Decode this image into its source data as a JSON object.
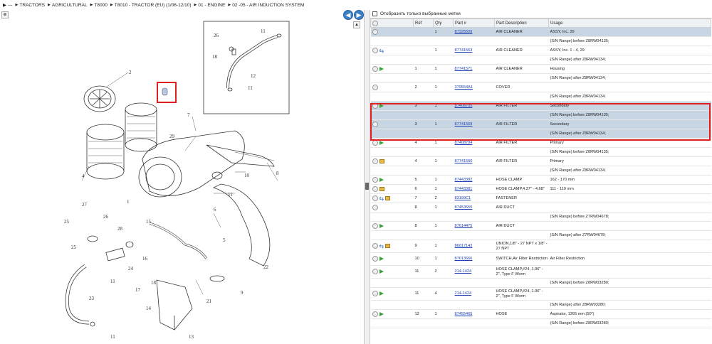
{
  "breadcrumb": {
    "items": [
      "---",
      "TRACTORS",
      "AGRICULTURAL",
      "T8000",
      "T8010 - TRACTOR (EU) (1/06-12/10)",
      "01 - ENGINE",
      "02 -05 - AIR INDUCTION SYSTEM"
    ]
  },
  "nav": {
    "back": "◀",
    "forward": "▶"
  },
  "filter": {
    "label": "Отобразить только выбранные метки"
  },
  "table": {
    "headers": [
      "",
      "Ref",
      "Qty",
      "Part #",
      "Part Description",
      "Usage"
    ],
    "rows": [
      {
        "icons": "",
        "ref": "",
        "qty": "1",
        "part": "87325509",
        "desc": "AIR CLEANER",
        "usage": "ASSY, Inc. 29",
        "sel": true
      },
      {
        "icons": "",
        "ref": "",
        "qty": "",
        "part": "",
        "desc": "",
        "usage": "(S/N Range) before Z8RW04135;",
        "sel": false
      },
      {
        "icons": "swap",
        "ref": "",
        "qty": "1",
        "part": "87741563",
        "desc": "AIR CLEANER",
        "usage": "ASSY, Inc. 1 - 4, 29",
        "sel": false
      },
      {
        "icons": "",
        "ref": "",
        "qty": "",
        "part": "",
        "desc": "",
        "usage": "(S/N Range) after Z8RW04134;",
        "sel": false
      },
      {
        "icons": "arrow",
        "ref": "1",
        "qty": "1",
        "part": "87741571",
        "desc": "AIR CLEANER",
        "usage": "Housing",
        "sel": false
      },
      {
        "icons": "",
        "ref": "",
        "qty": "",
        "part": "",
        "desc": "",
        "usage": "(S/N Range) after Z8RW04134;",
        "sel": false
      },
      {
        "icons": "",
        "ref": "2",
        "qty": "1",
        "part": "379554A1",
        "desc": "COVER",
        "usage": "",
        "sel": false
      },
      {
        "icons": "",
        "ref": "",
        "qty": "",
        "part": "",
        "desc": "",
        "usage": "(S/N Range) after Z8RW04134;",
        "sel": false
      },
      {
        "icons": "arrow",
        "ref": "3",
        "qty": "1",
        "part": "87408705",
        "desc": "AIR FILTER",
        "usage": "Secondary",
        "sel": true
      },
      {
        "icons": "",
        "ref": "",
        "qty": "",
        "part": "",
        "desc": "",
        "usage": "(S/N Range) before Z8RW04135;",
        "sel": true
      },
      {
        "icons": "",
        "ref": "3",
        "qty": "1",
        "part": "87741569",
        "desc": "AIR FILTER",
        "usage": "Secondary",
        "sel": true
      },
      {
        "icons": "",
        "ref": "",
        "qty": "",
        "part": "",
        "desc": "",
        "usage": "(S/N Range) after Z8RW04134;",
        "sel": true
      },
      {
        "icons": "arrow",
        "ref": "4",
        "qty": "1",
        "part": "87408704",
        "desc": "AIR FILTER",
        "usage": "Primary",
        "sel": false
      },
      {
        "icons": "",
        "ref": "",
        "qty": "",
        "part": "",
        "desc": "",
        "usage": "(S/N Range) before Z8RW04135;",
        "sel": false
      },
      {
        "icons": "box",
        "ref": "4",
        "qty": "1",
        "part": "87741560",
        "desc": "AIR FILTER",
        "usage": "Primary",
        "sel": false
      },
      {
        "icons": "",
        "ref": "",
        "qty": "",
        "part": "",
        "desc": "",
        "usage": "(S/N Range) after Z8RW04134;",
        "sel": false
      },
      {
        "icons": "arrow",
        "ref": "5",
        "qty": "1",
        "part": "87443382",
        "desc": "HOSE CLAMP",
        "usage": "162 - 170 mm",
        "sel": false
      },
      {
        "icons": "box",
        "ref": "6",
        "qty": "1",
        "part": "87443381",
        "desc": "HOSE CLAMP,4.37\" - 4.68\"",
        "usage": "111 - 119 mm",
        "sel": false
      },
      {
        "icons": "swapbox",
        "ref": "7",
        "qty": "2",
        "part": "83199C1",
        "desc": "FASTENER",
        "usage": "",
        "sel": false
      },
      {
        "icons": "",
        "ref": "8",
        "qty": "1",
        "part": "87453555",
        "desc": "AIR DUCT",
        "usage": "",
        "sel": false
      },
      {
        "icons": "",
        "ref": "",
        "qty": "",
        "part": "",
        "desc": "",
        "usage": "(S/N Range) before Z7RW04678;",
        "sel": false
      },
      {
        "icons": "arrow",
        "ref": "8",
        "qty": "1",
        "part": "87614475",
        "desc": "AIR DUCT",
        "usage": "",
        "sel": false
      },
      {
        "icons": "",
        "ref": "",
        "qty": "",
        "part": "",
        "desc": "",
        "usage": "(S/N Range) after Z7RW04678;",
        "sel": false
      },
      {
        "icons": "swapbox",
        "ref": "9",
        "qty": "1",
        "part": "86017142",
        "desc": "UNION,1/8\" - 27 NPT x 1/8\" - 27 NPT",
        "usage": "",
        "sel": false,
        "tall": true
      },
      {
        "icons": "arrow",
        "ref": "10",
        "qty": "1",
        "part": "87013666",
        "desc": "SWITCH,Air Filter Restriction",
        "usage": "Air Filter Restriction",
        "sel": false,
        "tall": true
      },
      {
        "icons": "arrow",
        "ref": "11",
        "qty": "2",
        "part": "214-1424",
        "desc": "HOSE CLAMP,#24, 1.06\" - 2\", Type F Worm",
        "usage": "",
        "sel": false,
        "tall": true
      },
      {
        "icons": "",
        "ref": "",
        "qty": "",
        "part": "",
        "desc": "",
        "usage": "(S/N Range) before Z8RW03280;",
        "sel": false
      },
      {
        "icons": "arrow",
        "ref": "11",
        "qty": "4",
        "part": "214-1424",
        "desc": "HOSE CLAMP,#24, 1.06\" - 2\", Type F Worm",
        "usage": "",
        "sel": false,
        "tall": true
      },
      {
        "icons": "",
        "ref": "",
        "qty": "",
        "part": "",
        "desc": "",
        "usage": "(S/N Range) after Z8RW03280;",
        "sel": false
      },
      {
        "icons": "arrow",
        "ref": "12",
        "qty": "1",
        "part": "87455465",
        "desc": "HOSE",
        "usage": "Aspirator, 1265 mm (50\")",
        "sel": false
      },
      {
        "icons": "",
        "ref": "",
        "qty": "",
        "part": "",
        "desc": "",
        "usage": "(S/N Range) before Z8RW03280;",
        "sel": false
      }
    ]
  },
  "diagram_labels": [
    "1",
    "2",
    "3",
    "4",
    "5",
    "6",
    "7",
    "8",
    "9",
    "10",
    "11",
    "11",
    "11",
    "11",
    "12",
    "13",
    "14",
    "15",
    "16",
    "17",
    "18",
    "19",
    "20",
    "21",
    "22",
    "23",
    "24",
    "25",
    "26",
    "26",
    "27",
    "28",
    "29"
  ],
  "colors": {
    "highlight": "#e02020",
    "selected_row": "#c8d6e4",
    "link": "#1a3fb4"
  }
}
